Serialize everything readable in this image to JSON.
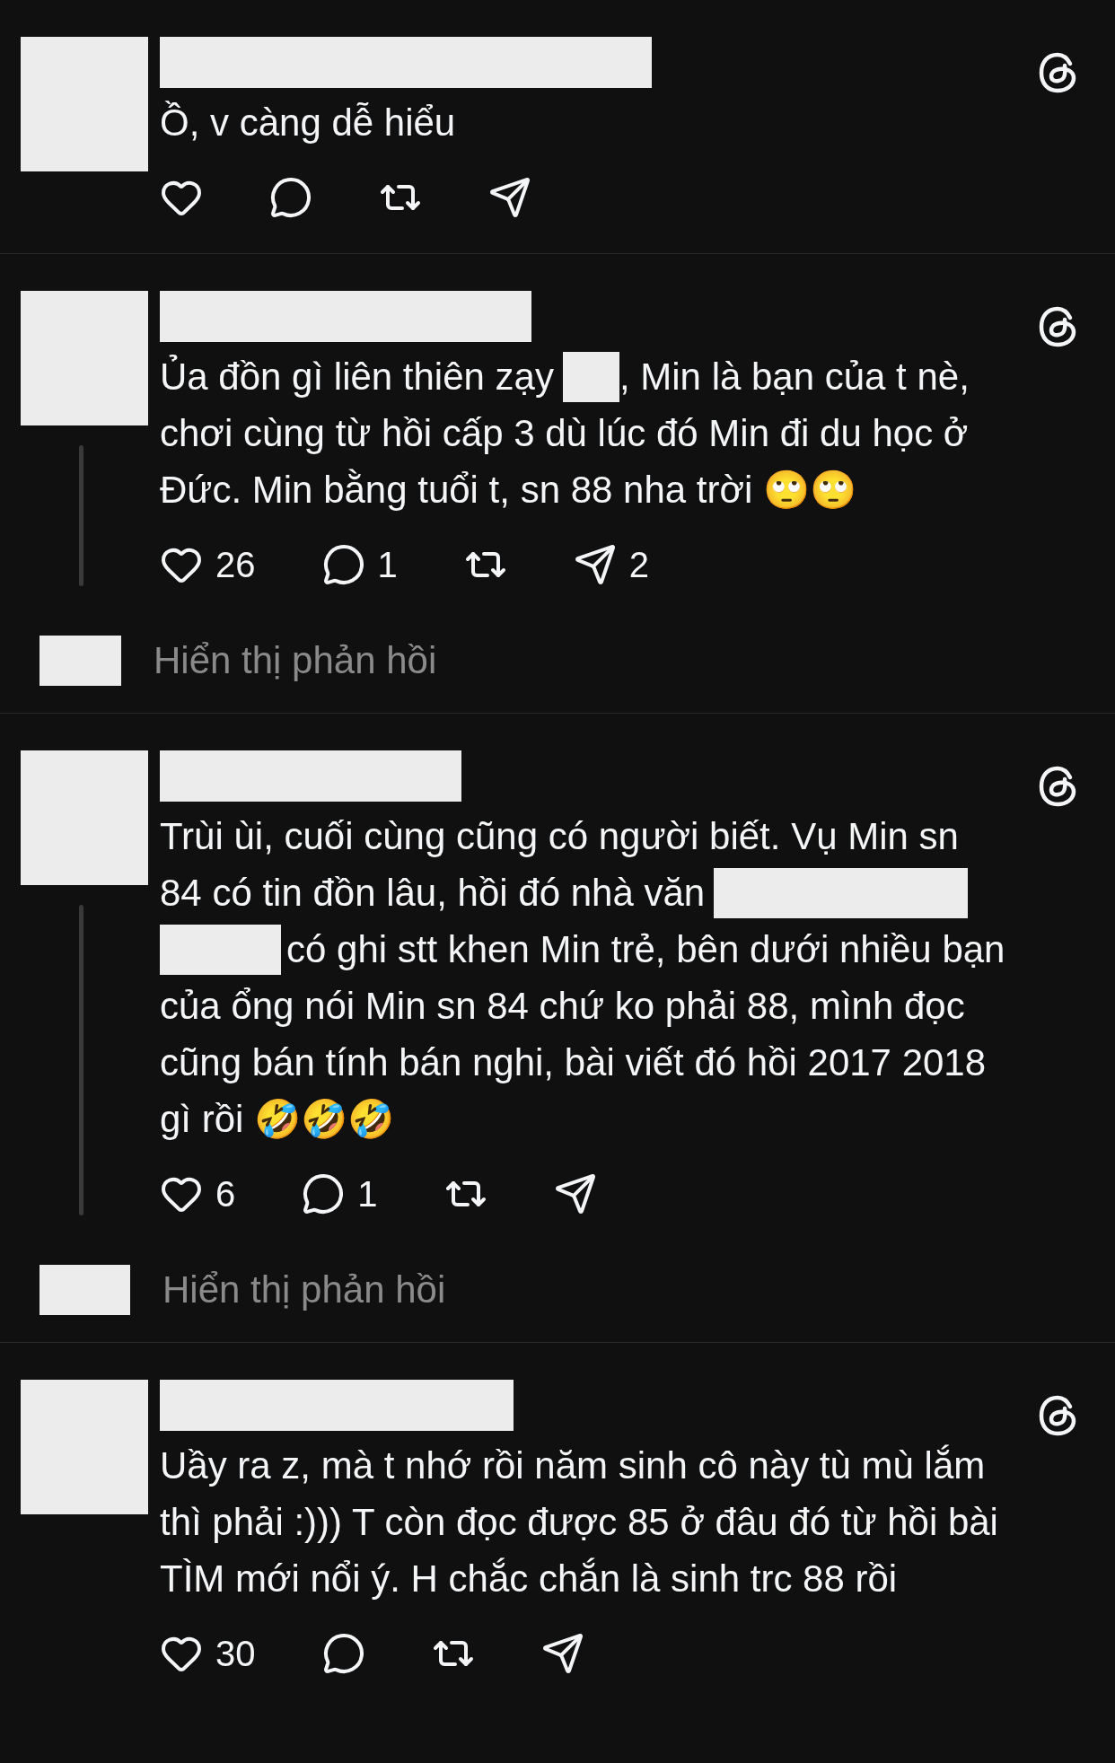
{
  "posts": [
    {
      "lines": [
        [
          {
            "kind": "text",
            "text": "Ồ, v càng dễ hiểu"
          }
        ]
      ],
      "actions": [
        {
          "kind": "like"
        },
        {
          "kind": "reply"
        },
        {
          "kind": "repost"
        },
        {
          "kind": "share"
        }
      ]
    },
    {
      "lines": [
        [
          {
            "kind": "text",
            "text": "Ủa đồn gì liên thiên zạy"
          },
          {
            "kind": "redacted"
          },
          {
            "kind": "text",
            "text": ", Min là bạn của t nè,"
          }
        ],
        [
          {
            "kind": "text",
            "text": "chơi cùng từ hồi cấp 3 dù lúc đó Min đi du học ở"
          }
        ],
        [
          {
            "kind": "text",
            "text": "Đức. Min bằng tuổi t, sn 88 nha trời 🙄🙄"
          }
        ]
      ],
      "actions": [
        {
          "kind": "like",
          "count": "26"
        },
        {
          "kind": "reply",
          "count": "1"
        },
        {
          "kind": "repost"
        },
        {
          "kind": "share",
          "count": "2"
        }
      ],
      "show_replies": "Hiển thị phản hồi"
    },
    {
      "lines": [
        [
          {
            "kind": "text",
            "text": "Trùi ùi, cuối cùng cũng có người biết. Vụ Min sn"
          }
        ],
        [
          {
            "kind": "text",
            "text": "84 có tin đồn lâu, hồi đó nhà văn"
          },
          {
            "kind": "redacted"
          }
        ],
        [
          {
            "kind": "redacted"
          },
          {
            "kind": "text",
            "text": "có ghi stt khen Min trẻ, bên dưới nhiều bạn"
          }
        ],
        [
          {
            "kind": "text",
            "text": "của ổng nói Min sn 84 chứ ko phải 88, mình đọc"
          }
        ],
        [
          {
            "kind": "text",
            "text": "cũng bán tính bán nghi, bài viết đó hồi 2017 2018"
          }
        ],
        [
          {
            "kind": "text",
            "text": "gì rồi 🤣🤣🤣"
          }
        ]
      ],
      "actions": [
        {
          "kind": "like",
          "count": "6"
        },
        {
          "kind": "reply",
          "count": "1"
        },
        {
          "kind": "repost"
        },
        {
          "kind": "share"
        }
      ],
      "show_replies": "Hiển thị phản hồi"
    },
    {
      "lines": [
        [
          {
            "kind": "text",
            "text": "Uầy ra z, mà t nhớ rồi năm sinh cô này tù mù lắm"
          }
        ],
        [
          {
            "kind": "text",
            "text": "thì phải :))) T còn đọc được 85 ở đâu đó từ hồi bài"
          }
        ],
        [
          {
            "kind": "text",
            "text": "TÌM mới nổi ý. H chắc chắn là sinh trc 88 rồi"
          }
        ]
      ],
      "actions": [
        {
          "kind": "like",
          "count": "30"
        },
        {
          "kind": "reply"
        },
        {
          "kind": "repost"
        },
        {
          "kind": "share"
        }
      ]
    }
  ]
}
